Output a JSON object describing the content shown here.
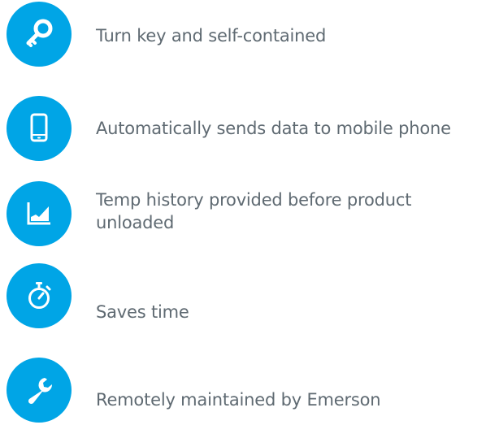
{
  "colors": {
    "accent": "#00a5e6",
    "text": "#5f6a72",
    "background": "#ffffff"
  },
  "features": [
    {
      "icon": "key-icon",
      "label": "Turn key and self-contained"
    },
    {
      "icon": "mobile-phone-icon",
      "label": "Automatically sends data to mobile phone"
    },
    {
      "icon": "area-chart-icon",
      "label": "Temp history provided before product unloaded"
    },
    {
      "icon": "stopwatch-icon",
      "label": "Saves time"
    },
    {
      "icon": "wrench-icon",
      "label": "Remotely maintained by Emerson"
    }
  ]
}
